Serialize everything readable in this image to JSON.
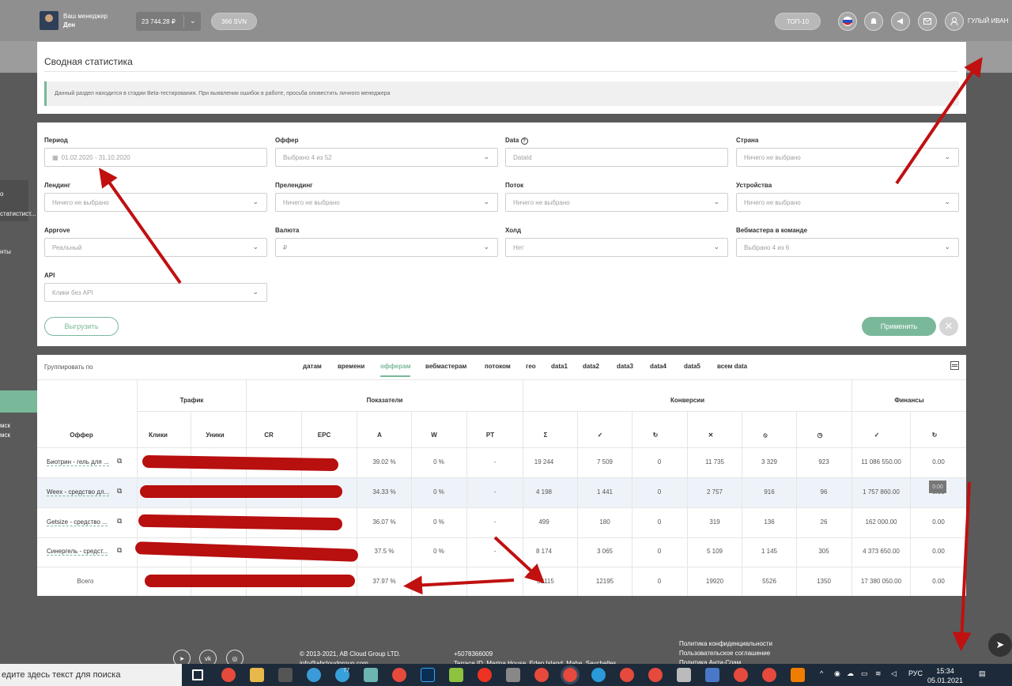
{
  "header": {
    "manager_label": "Ваш менеджер",
    "manager_name": "Ден",
    "balance": "23 744.28 ₽",
    "svn": "366 SVN",
    "top_button": "ТОП-10",
    "user_name": "ГУЛЫЙ ИВАН"
  },
  "sidebar": {
    "items": [
      "о",
      "статистист...",
      "нты",
      "мск",
      "мск"
    ]
  },
  "summary": {
    "title": "Сводная статистика",
    "beta_notice": "Данный раздел находится в стадии Beta-тестирования. При выявлении ошибок в работе, просьба оповестить личного менеджера"
  },
  "filters": {
    "period": {
      "label": "Период",
      "value": "01.02.2020 - 31.10.2020"
    },
    "offer": {
      "label": "Оффер",
      "value": "Выбрано 4 из 52"
    },
    "data": {
      "label": "Data",
      "placeholder": "DataId"
    },
    "country": {
      "label": "Страна",
      "value": "Ничего не выбрано"
    },
    "landing": {
      "label": "Лендинг",
      "value": "Ничего не выбрано"
    },
    "prelanding": {
      "label": "Прелендинг",
      "value": "Ничего не выбрано"
    },
    "stream": {
      "label": "Поток",
      "value": "Ничего не выбрано"
    },
    "devices": {
      "label": "Устройства",
      "value": "Ничего не выбрано"
    },
    "approve": {
      "label": "Approve",
      "value": "Реальный"
    },
    "currency": {
      "label": "Валюта",
      "value": "₽"
    },
    "hold": {
      "label": "Холд",
      "value": "Нет"
    },
    "webmasters": {
      "label": "Вебмастера в команде",
      "value": "Выбрано 4 из 6"
    },
    "api": {
      "label": "API",
      "value": "Клики без API"
    },
    "export_button": "Выгрузить",
    "apply_button": "Применить"
  },
  "grouping": {
    "label": "Группировать по",
    "tabs": [
      "датам",
      "времени",
      "офферам",
      "вебмастерам",
      "потоком",
      "гео",
      "data1",
      "data2",
      "data3",
      "data4",
      "data5",
      "всем data"
    ],
    "active": "офферам"
  },
  "table": {
    "groups": [
      "Трафик",
      "Показатели",
      "Конверсии",
      "Финансы"
    ],
    "columns": [
      "Оффер",
      "Клики",
      "Уники",
      "CR",
      "EPC",
      "A",
      "W",
      "PT",
      "Σ",
      "✓",
      "↻",
      "✕",
      "⦸",
      "◷",
      "✓",
      "↻"
    ],
    "rows": [
      {
        "offer": "Биотрин - гель для ...",
        "a": "39.02 %",
        "w": "0 %",
        "pt": "-",
        "sum": "19 244",
        "ok": "7 509",
        "hold": "0",
        "rej": "11 735",
        "trash": "3 329",
        "wait": "923",
        "fin_ok": "11 086 550.00",
        "fin_hold": "0.00"
      },
      {
        "offer": "Weex - средство дл...",
        "a": "34.33 %",
        "w": "0 %",
        "pt": "-",
        "sum": "4 198",
        "ok": "1 441",
        "hold": "0",
        "rej": "2 757",
        "trash": "916",
        "wait": "96",
        "fin_ok": "1 757 860.00",
        "fin_hold": "0.00"
      },
      {
        "offer": "Getsize - средство ...",
        "a": "36.07 %",
        "w": "0 %",
        "pt": "-",
        "sum": "499",
        "ok": "180",
        "hold": "0",
        "rej": "319",
        "trash": "136",
        "wait": "26",
        "fin_ok": "162 000.00",
        "fin_hold": "0.00"
      },
      {
        "offer": "Синергель - средст...",
        "a": "37.5 %",
        "w": "0 %",
        "pt": "-",
        "sum": "8 174",
        "ok": "3 065",
        "hold": "0",
        "rej": "5 109",
        "trash": "1 145",
        "wait": "305",
        "fin_ok": "4 373 650.00",
        "fin_hold": "0.00"
      }
    ],
    "total": {
      "offer": "Всего",
      "a": "37.97 %",
      "pt": "-",
      "sum": "32115",
      "ok": "12195",
      "hold": "0",
      "rej": "19920",
      "trash": "5526",
      "wait": "1350",
      "fin_ok": "17 380 050.00",
      "fin_hold": "0.00"
    },
    "tooltip": "0.00"
  },
  "footer": {
    "copyright": "© 2013-2021, AB Cloud Group LTD.",
    "email": "info@abcloudgroup.com",
    "phone": "+5078366009",
    "address": "Terrace ID, Marina House, Eden Island, Mahe, Seychelles",
    "links": [
      "Политика конфиденциальности",
      "Пользовательское соглашение",
      "Политика Анти-Спам"
    ],
    "social": [
      "telegram-icon",
      "vk-icon",
      "instagram-icon"
    ]
  },
  "taskbar": {
    "search_text": "едите здесь текст для поиска",
    "lang": "РУС",
    "time": "15:34",
    "date": "05.01.2021",
    "badge": "77"
  },
  "colors": {
    "accent": "#7ab89a",
    "redaction": "#b80f0f",
    "background": "#5a5a5a"
  }
}
